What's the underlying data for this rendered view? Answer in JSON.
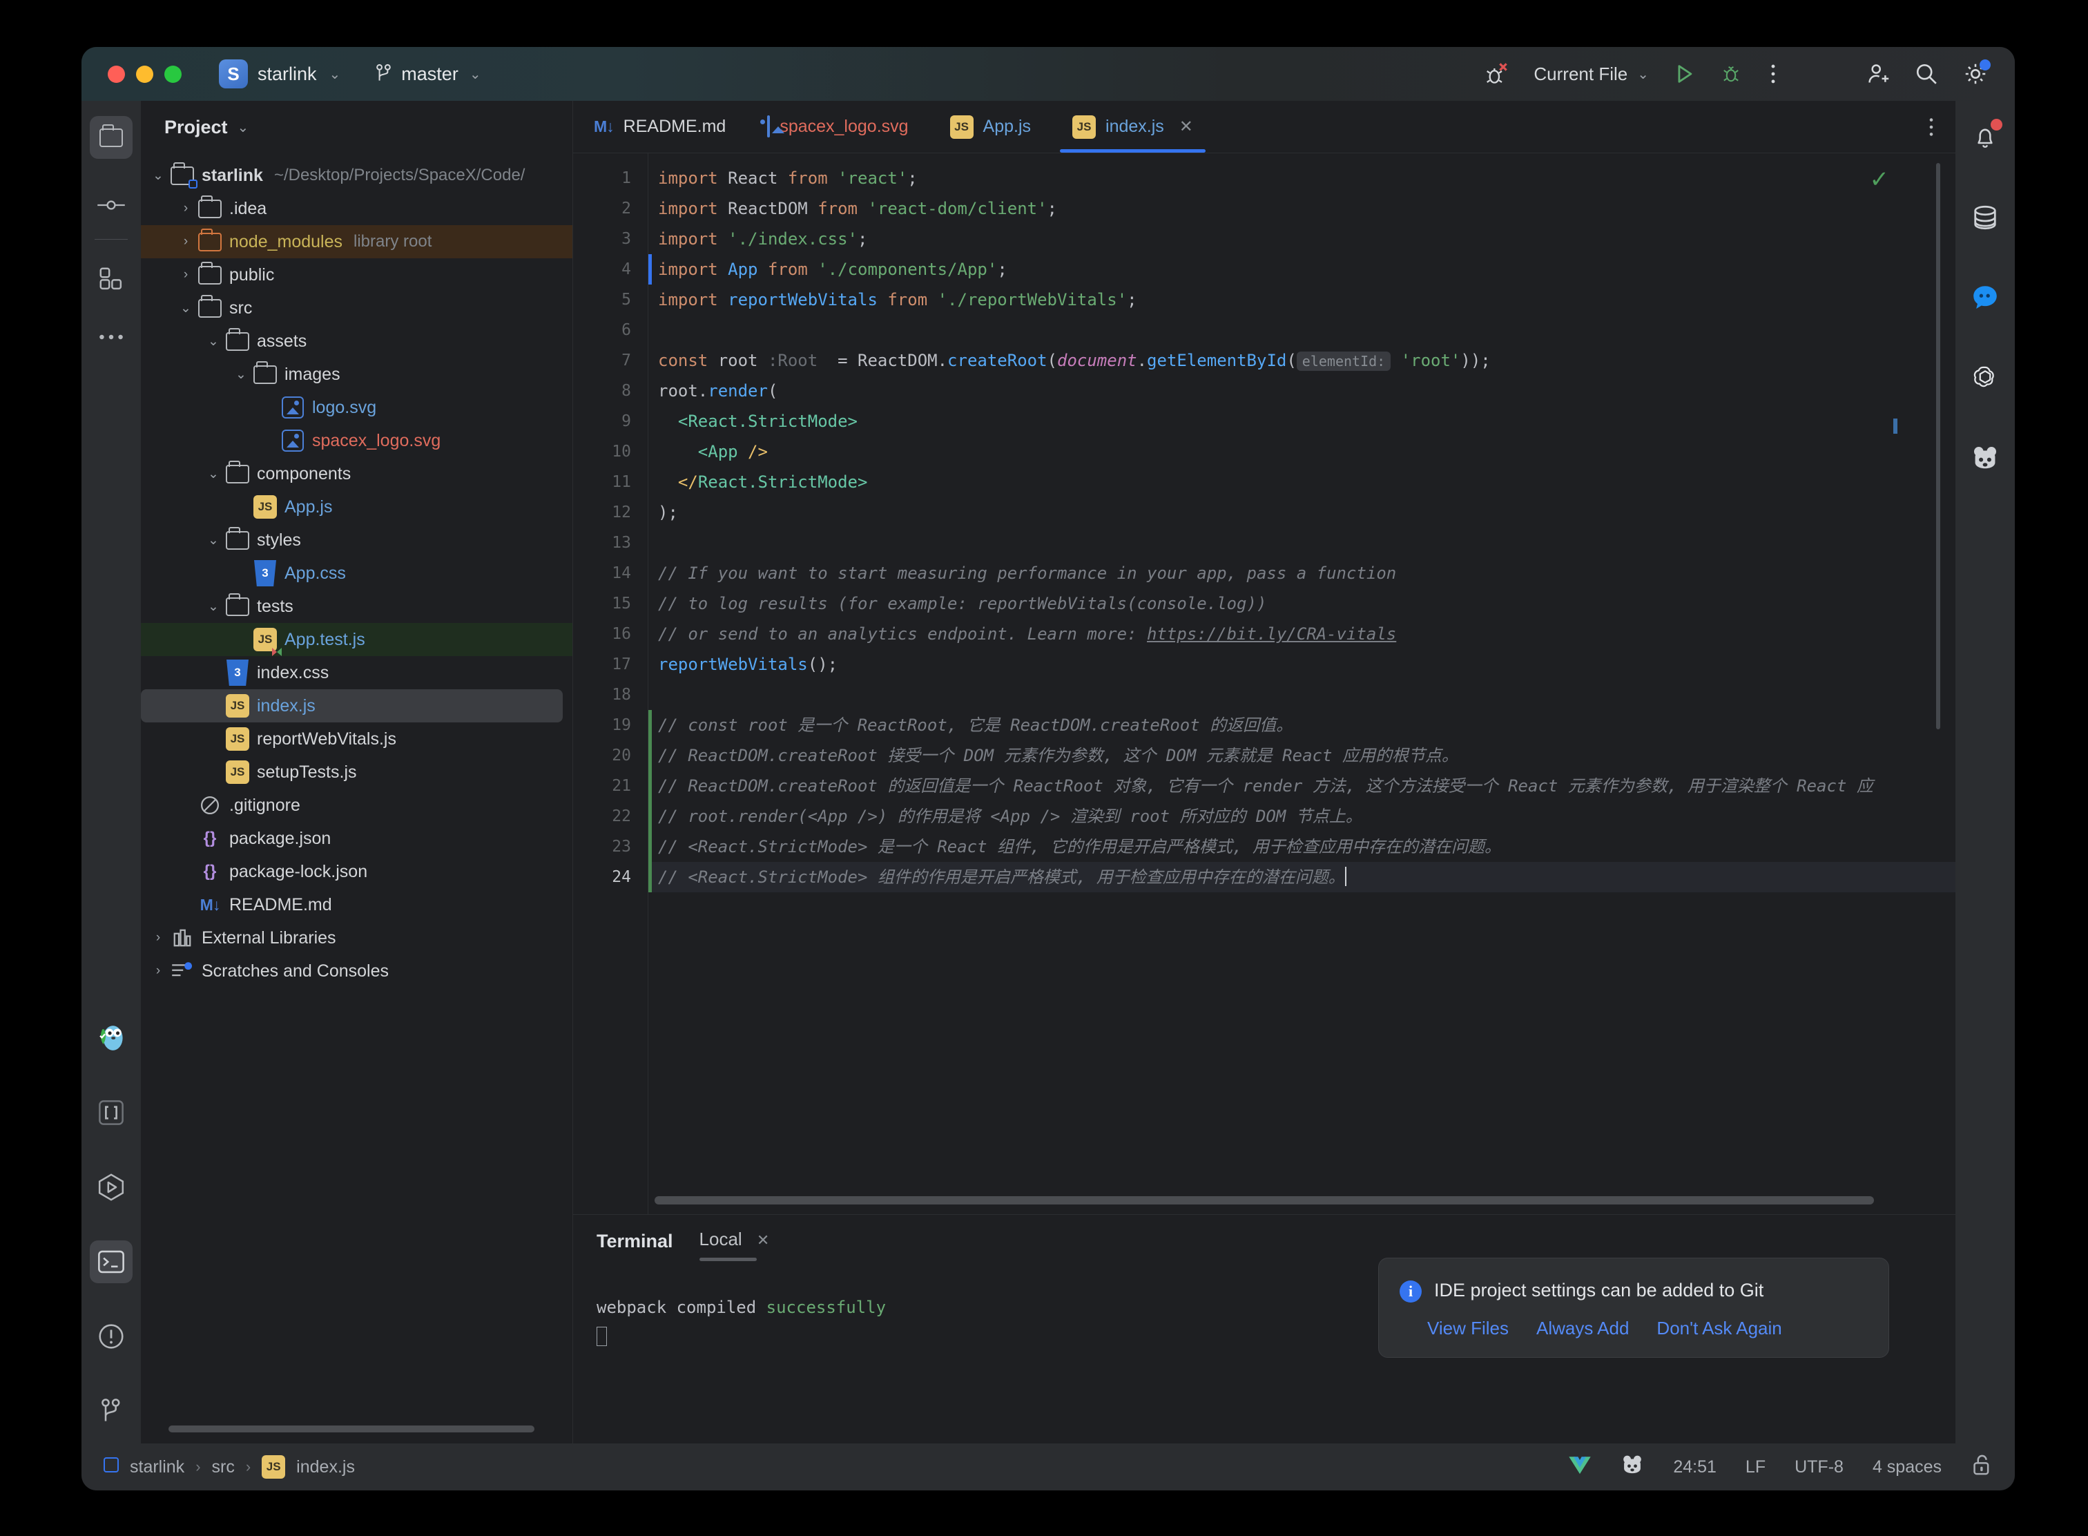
{
  "titlebar": {
    "project_name": "starlink",
    "project_badge": "S",
    "branch": "master",
    "run_config": "Current File",
    "icons": {
      "debug_error": "bug-error-icon",
      "run": "run-icon",
      "debug": "debug-icon",
      "more": "more-vertical-icon",
      "add_user": "add-user-icon",
      "search": "search-icon",
      "settings": "settings-gear-icon"
    }
  },
  "left_stripe": {
    "top": [
      {
        "name": "project-tool-window",
        "icon": "folder-icon",
        "active": true
      },
      {
        "name": "commit-tool-window",
        "icon": "commit-icon",
        "active": false
      },
      {
        "name": "plugins-tool-window",
        "icon": "squares-icon",
        "active": false
      },
      {
        "name": "more-tool-windows",
        "icon": "ellipsis-icon",
        "active": false
      }
    ],
    "bottom": [
      {
        "name": "go-tool-window",
        "icon": "gopher-icon",
        "active": false
      },
      {
        "name": "structure-tool-window",
        "icon": "brackets-icon",
        "active": false
      },
      {
        "name": "run-tool-window",
        "icon": "hexagon-play-icon",
        "active": false
      },
      {
        "name": "terminal-tool-window",
        "icon": "terminal-icon",
        "active": true
      },
      {
        "name": "problems-tool-window",
        "icon": "exclamation-circle-icon",
        "active": false
      },
      {
        "name": "git-tool-window",
        "icon": "git-branch-icon",
        "active": false
      }
    ]
  },
  "right_stripe": [
    {
      "name": "notifications",
      "icon": "bell-icon",
      "badge": true
    },
    {
      "name": "database",
      "icon": "database-icon",
      "badge": false
    },
    {
      "name": "ai-chat",
      "icon": "chat-bubble-icon",
      "badge": false
    },
    {
      "name": "openai-assistant",
      "icon": "openai-icon",
      "badge": false
    },
    {
      "name": "codeium-assistant",
      "icon": "panda-icon",
      "badge": false
    }
  ],
  "project_panel": {
    "title": "Project",
    "tree": [
      {
        "depth": 0,
        "arrow": "v",
        "icon": "module-folder",
        "label": "starlink",
        "sub": "~/Desktop/Projects/SpaceX/Code/",
        "color": "white",
        "bold": true
      },
      {
        "depth": 1,
        "arrow": ">",
        "icon": "folder",
        "label": ".idea",
        "sub": "",
        "color": "white"
      },
      {
        "depth": 1,
        "arrow": ">",
        "icon": "folder-orange",
        "label": "node_modules",
        "sub": "library root",
        "color": "yellow",
        "highlight": "node"
      },
      {
        "depth": 1,
        "arrow": ">",
        "icon": "folder",
        "label": "public",
        "sub": "",
        "color": "white"
      },
      {
        "depth": 1,
        "arrow": "v",
        "icon": "folder",
        "label": "src",
        "sub": "",
        "color": "white"
      },
      {
        "depth": 2,
        "arrow": "v",
        "icon": "folder",
        "label": "assets",
        "sub": "",
        "color": "white"
      },
      {
        "depth": 3,
        "arrow": "v",
        "icon": "folder",
        "label": "images",
        "sub": "",
        "color": "white"
      },
      {
        "depth": 4,
        "arrow": "",
        "icon": "svg",
        "label": "logo.svg",
        "sub": "",
        "color": "blue"
      },
      {
        "depth": 4,
        "arrow": "",
        "icon": "svg",
        "label": "spacex_logo.svg",
        "sub": "",
        "color": "red"
      },
      {
        "depth": 2,
        "arrow": "v",
        "icon": "folder",
        "label": "components",
        "sub": "",
        "color": "white"
      },
      {
        "depth": 3,
        "arrow": "",
        "icon": "js",
        "label": "App.js",
        "sub": "",
        "color": "blue"
      },
      {
        "depth": 2,
        "arrow": "v",
        "icon": "folder",
        "label": "styles",
        "sub": "",
        "color": "white"
      },
      {
        "depth": 3,
        "arrow": "",
        "icon": "css",
        "label": "App.css",
        "sub": "",
        "color": "blue"
      },
      {
        "depth": 2,
        "arrow": "v",
        "icon": "folder",
        "label": "tests",
        "sub": "",
        "color": "white"
      },
      {
        "depth": 3,
        "arrow": "",
        "icon": "js-test",
        "label": "App.test.js",
        "sub": "",
        "color": "blue",
        "highlight": "test"
      },
      {
        "depth": 2,
        "arrow": "",
        "icon": "css",
        "label": "index.css",
        "sub": "",
        "color": "white"
      },
      {
        "depth": 2,
        "arrow": "",
        "icon": "js",
        "label": "index.js",
        "sub": "",
        "color": "blue",
        "selected": true
      },
      {
        "depth": 2,
        "arrow": "",
        "icon": "js",
        "label": "reportWebVitals.js",
        "sub": "",
        "color": "white"
      },
      {
        "depth": 2,
        "arrow": "",
        "icon": "js",
        "label": "setupTests.js",
        "sub": "",
        "color": "white"
      },
      {
        "depth": 1,
        "arrow": "",
        "icon": "gitignore",
        "label": ".gitignore",
        "sub": "",
        "color": "white"
      },
      {
        "depth": 1,
        "arrow": "",
        "icon": "json",
        "label": "package.json",
        "sub": "",
        "color": "white"
      },
      {
        "depth": 1,
        "arrow": "",
        "icon": "json",
        "label": "package-lock.json",
        "sub": "",
        "color": "white"
      },
      {
        "depth": 1,
        "arrow": "",
        "icon": "md",
        "label": "README.md",
        "sub": "",
        "color": "white"
      },
      {
        "depth": 0,
        "arrow": ">",
        "icon": "libs",
        "label": "External Libraries",
        "sub": "",
        "color": "white"
      },
      {
        "depth": 0,
        "arrow": ">",
        "icon": "scratches",
        "label": "Scratches and Consoles",
        "sub": "",
        "color": "white"
      }
    ]
  },
  "editor": {
    "tabs": [
      {
        "label": "README.md",
        "icon": "md",
        "active": false,
        "closable": false,
        "color": "white"
      },
      {
        "label": "spacex_logo.svg",
        "icon": "svg",
        "active": false,
        "closable": false,
        "color": "red"
      },
      {
        "label": "App.js",
        "icon": "js",
        "active": false,
        "closable": false,
        "color": "blue"
      },
      {
        "label": "index.js",
        "icon": "js",
        "active": true,
        "closable": true,
        "color": "blue"
      }
    ],
    "lines": [
      {
        "n": 1,
        "html": "<span class='kw'>import</span> <span class='id'>React</span> <span class='kw'>from</span> <span class='str'>'react'</span>;"
      },
      {
        "n": 2,
        "html": "<span class='kw'>import</span> <span class='id'>ReactDOM</span> <span class='kw'>from</span> <span class='str'>'react-dom/client'</span>;"
      },
      {
        "n": 3,
        "html": "<span class='kw'>import</span> <span class='str'>'./index.css'</span>;"
      },
      {
        "n": 4,
        "html": "<span class='kw'>import</span> <span class='fn'>App</span> <span class='kw'>from</span> <span class='str'>'./components/App'</span>;",
        "marker": true
      },
      {
        "n": 5,
        "html": "<span class='kw'>import</span> <span class='fn'>reportWebVitals</span> <span class='kw'>from</span> <span class='str'>'./reportWebVitals'</span>;"
      },
      {
        "n": 6,
        "html": ""
      },
      {
        "n": 7,
        "html": "<span class='kw'>const</span> <span class='id'>root</span> <span class='typ'>:Root</span>  = <span class='id'>ReactDOM</span>.<span class='fn'>createRoot</span>(<span class='doc'>document</span>.<span class='fn'>getElementById</span>(<span class='hint'>elementId:</span> <span class='str'>'root'</span>));"
      },
      {
        "n": 8,
        "html": "<span class='id'>root</span>.<span class='fn'>render</span>("
      },
      {
        "n": 9,
        "html": "  <span class='jsx'>&lt;React.StrictMode&gt;</span>"
      },
      {
        "n": 10,
        "html": "    <span class='jsx'>&lt;App</span> <span class='brk'>/&gt;</span>"
      },
      {
        "n": 11,
        "html": "  <span class='brk'>&lt;/</span><span class='jsx'>React.StrictMode&gt;</span>"
      },
      {
        "n": 12,
        "html": ");"
      },
      {
        "n": 13,
        "html": ""
      },
      {
        "n": 14,
        "html": "<span class='cm'>// If you want to start measuring performance in your app, pass a function</span>"
      },
      {
        "n": 15,
        "html": "<span class='cm'>// to log results (for example: reportWebVitals(console.log))</span>"
      },
      {
        "n": 16,
        "html": "<span class='cm'>// or send to an analytics endpoint. Learn more: </span><span class='lnk'>https://bit.ly/CRA-vitals</span>"
      },
      {
        "n": 17,
        "html": "<span class='fn'>reportWebVitals</span>();"
      },
      {
        "n": 18,
        "html": ""
      },
      {
        "n": 19,
        "html": "<span class='cm'>// const root 是一个 ReactRoot, 它是 ReactDOM.createRoot 的返回值。</span>",
        "changed": true
      },
      {
        "n": 20,
        "html": "<span class='cm'>// ReactDOM.createRoot 接受一个 DOM 元素作为参数, 这个 DOM 元素就是 React 应用的根节点。</span>",
        "changed": true
      },
      {
        "n": 21,
        "html": "<span class='cm'>// ReactDOM.createRoot 的返回值是一个 ReactRoot 对象, 它有一个 render 方法, 这个方法接受一个 React 元素作为参数, 用于渲染整个 React 应</span>",
        "changed": true
      },
      {
        "n": 22,
        "html": "<span class='cm'>// root.render(&lt;App /&gt;) 的作用是将 &lt;App /&gt; 渲染到 root 所对应的 DOM 节点上。</span>",
        "changed": true
      },
      {
        "n": 23,
        "html": "<span class='cm'>// &lt;React.StrictMode&gt; 是一个 React 组件, 它的作用是开启严格模式, 用于检查应用中存在的潜在问题。</span>",
        "changed": true
      },
      {
        "n": 24,
        "html": "<span class='cm'>// &lt;React.StrictMode&gt; 组件的作用是开启严格模式, 用于检查应用中存在的潜在问题。</span><span class='caret'></span>",
        "current": true,
        "changed": true
      }
    ]
  },
  "terminal": {
    "title": "Terminal",
    "tab_label": "Local",
    "output_prefix": "webpack compiled ",
    "output_status": "successfully"
  },
  "notification": {
    "message": "IDE project settings can be added to Git",
    "actions": [
      "View Files",
      "Always Add",
      "Don't Ask Again"
    ]
  },
  "statusbar": {
    "breadcrumbs": [
      "starlink",
      "src",
      "index.js"
    ],
    "caret_position": "24:51",
    "line_separator": "LF",
    "encoding": "UTF-8",
    "indent": "4 spaces",
    "lock_icon": "unlocked-icon"
  },
  "colors": {
    "accent": "#3574f0",
    "link": "#548af7",
    "success_green": "#6aab73",
    "window_bg": "#1e1f22",
    "panel_bg": "#2b2d30"
  }
}
